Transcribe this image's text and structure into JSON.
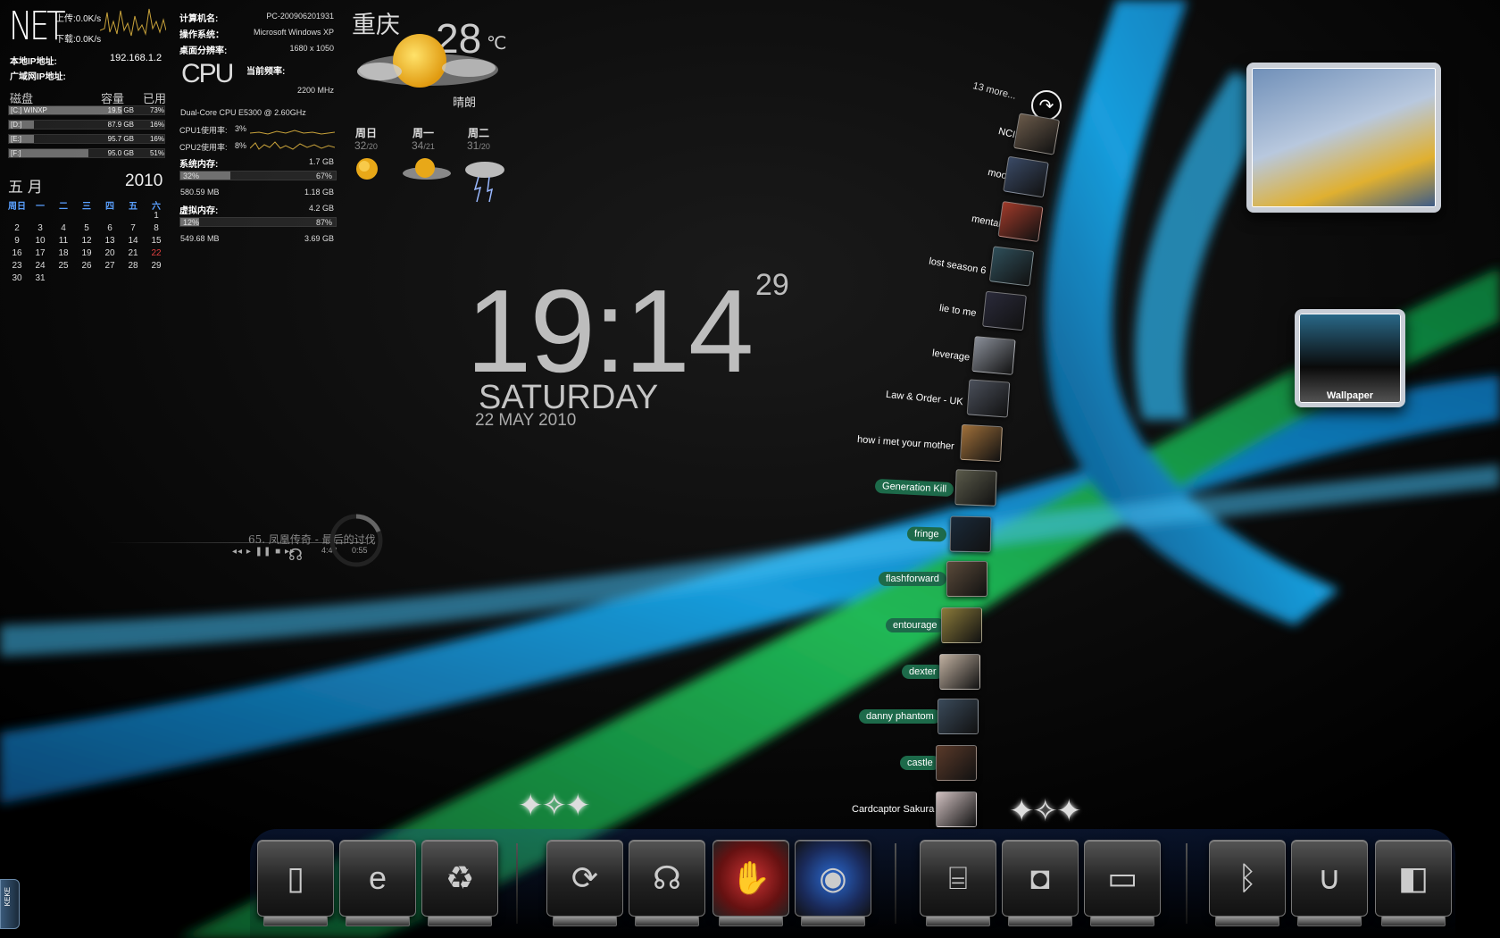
{
  "net": {
    "title": "NET",
    "upload_label": "上传:0.0K/s",
    "download_label": "下载:0.0K/s",
    "local_ip_label": "本地IP地址:",
    "local_ip_value": "192.168.1.2",
    "wan_ip_label": "广域网IP地址:"
  },
  "disks": {
    "header_disk": "磁盘",
    "header_capacity": "容量",
    "header_used": "已用",
    "rows": [
      {
        "name": "[C:] WINXP",
        "size": "19.5 GB",
        "used": "73%",
        "pct": 0.73
      },
      {
        "name": "[D:]",
        "size": "87.9 GB",
        "used": "16%",
        "pct": 0.16
      },
      {
        "name": "[E:]",
        "size": "95.7 GB",
        "used": "16%",
        "pct": 0.16
      },
      {
        "name": "[F:]",
        "size": "95.0 GB",
        "used": "51%",
        "pct": 0.51
      }
    ]
  },
  "calendar": {
    "month": "五 月",
    "year": "2010",
    "weekdays": [
      "周日",
      "一",
      "二",
      "三",
      "四",
      "五",
      "六"
    ],
    "cells": [
      "",
      "",
      "",
      "",
      "",
      "",
      "1",
      "2",
      "3",
      "4",
      "5",
      "6",
      "7",
      "8",
      "9",
      "10",
      "11",
      "12",
      "13",
      "14",
      "15",
      "16",
      "17",
      "18",
      "19",
      "20",
      "21",
      "22",
      "23",
      "24",
      "25",
      "26",
      "27",
      "28",
      "29",
      "30",
      "31"
    ],
    "today": "22",
    "today_color": "#e04040"
  },
  "sysinfo": {
    "computer_label": "计算机名:",
    "computer_value": "PC-200906201931",
    "os_label": "操作系统：",
    "os_value": "Microsoft Windows XP",
    "res_label": "桌面分辨率:",
    "res_value": "1680 x 1050",
    "cpu_logo": "CPU",
    "freq_label": "当前频率:",
    "freq_value": "2200 MHz",
    "cpu_name": "Dual-Core CPU E5300 @ 2.60GHz",
    "cpu1_label": "CPU1使用率:",
    "cpu1_value": "3%",
    "cpu2_label": "CPU2使用率:",
    "cpu2_value": "8%",
    "mem_label": "系统内存:",
    "mem_total": "1.7 GB",
    "mem_pct_used": "32%",
    "mem_pct_free": "67%",
    "mem_pct": 0.32,
    "mem_used": "580.59 MB",
    "mem_free": "1.18 GB",
    "vmem_label": "虚拟内存:",
    "vmem_total": "4.2 GB",
    "vmem_pct_used": "12%",
    "vmem_pct_free": "87%",
    "vmem_pct": 0.12,
    "vmem_used": "549.68 MB",
    "vmem_free": "3.69 GB"
  },
  "weather": {
    "city": "重庆",
    "temp": "28",
    "unit": "℃",
    "condition": "晴朗",
    "forecast": [
      {
        "day": "周日",
        "hi": "32",
        "lo": "/20",
        "icon": "sun-icon"
      },
      {
        "day": "周一",
        "hi": "34",
        "lo": "/21",
        "icon": "partly-cloudy-icon"
      },
      {
        "day": "周二",
        "hi": "31",
        "lo": "/20",
        "icon": "thunderstorm-icon"
      }
    ]
  },
  "clock": {
    "time": "19:14",
    "seconds": "29",
    "day": "SATURDAY",
    "date": "22 MAY 2010"
  },
  "player": {
    "track": "65. 凤凰传奇 - 最后的讨伐",
    "duration": "4:42",
    "elapsed": "0:55",
    "controls": "◂◂ ▸ ❚❚ ■ ▸▸"
  },
  "shows": {
    "more_label": "13 more...",
    "items": [
      {
        "label": "NCIS",
        "color": "#6a5a4a"
      },
      {
        "label": "moonlight",
        "color": "#3a4a66"
      },
      {
        "label": "mental",
        "color": "#a03a2a"
      },
      {
        "label": "lost season 6",
        "color": "#2f4f5a"
      },
      {
        "label": "lie to me",
        "color": "#2a2a3a"
      },
      {
        "label": "leverage",
        "color": "#8a8f99"
      },
      {
        "label": "Law & Order - UK",
        "color": "#4a4f5a"
      },
      {
        "label": "how i met your mother",
        "color": "#a0703a"
      },
      {
        "label": "Generation Kill",
        "color": "#5a5a4a"
      },
      {
        "label": "fringe",
        "color": "#1a2a3a"
      },
      {
        "label": "flashforward",
        "color": "#5a4a3a"
      },
      {
        "label": "entourage",
        "color": "#8a7a3a"
      },
      {
        "label": "dexter",
        "color": "#c0b0a0"
      },
      {
        "label": "danny phantom",
        "color": "#3a4a5a"
      },
      {
        "label": "castle",
        "color": "#5a3a2a"
      },
      {
        "label": "Cardcaptor Sakura",
        "color": "#d0c0c0"
      }
    ]
  },
  "gadgets": {
    "wallpaper_label": "Wallpaper"
  },
  "dock": {
    "icons": [
      {
        "name": "documents-icon",
        "glyph": "▯"
      },
      {
        "name": "internet-explorer-icon",
        "glyph": "e"
      },
      {
        "name": "recycle-bin-icon",
        "glyph": "♻"
      },
      {
        "name": "refresh-icon",
        "glyph": "⟳"
      },
      {
        "name": "headphones-icon",
        "glyph": "☊"
      },
      {
        "name": "stop-hand-icon",
        "glyph": "✋"
      },
      {
        "name": "media-center-icon",
        "glyph": "◉"
      },
      {
        "name": "scanner-icon",
        "glyph": "⌸"
      },
      {
        "name": "camera-icon",
        "glyph": "◘"
      },
      {
        "name": "iphone-icon",
        "glyph": "▭"
      },
      {
        "name": "bluetooth-icon",
        "glyph": "ᛒ"
      },
      {
        "name": "magnet-icon",
        "glyph": "∪"
      },
      {
        "name": "window-icon",
        "glyph": "◧"
      }
    ]
  },
  "side_tab": "KEKE"
}
